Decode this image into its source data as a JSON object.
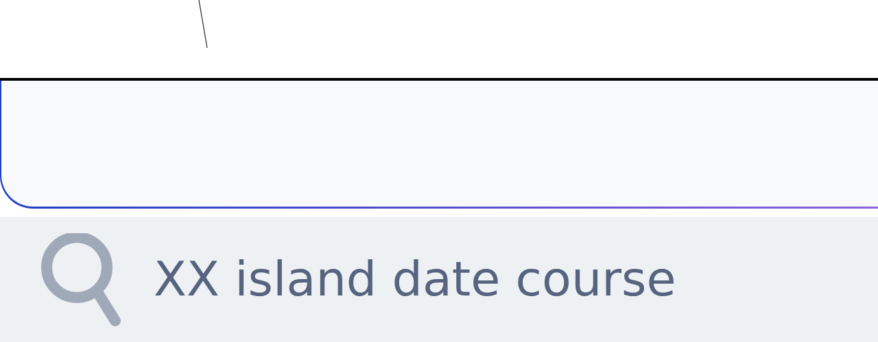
{
  "search": {
    "value": "XX island date course"
  }
}
